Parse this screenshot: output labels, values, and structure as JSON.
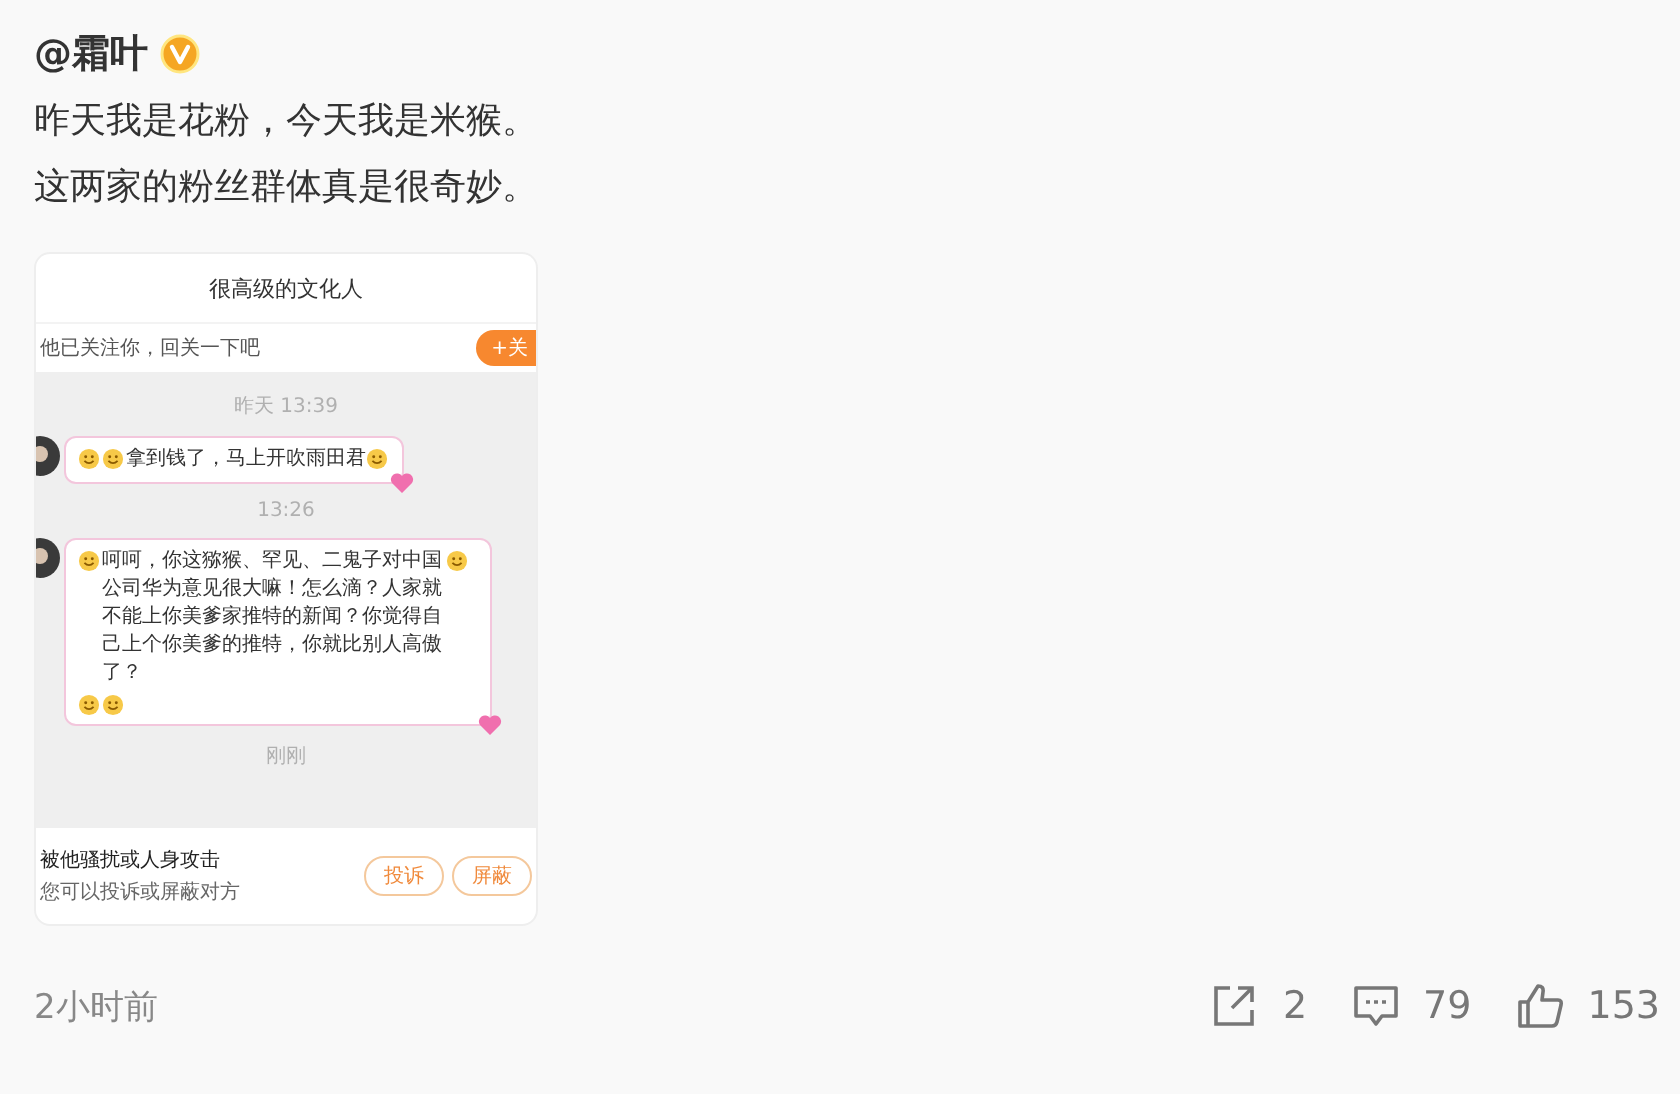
{
  "author": {
    "name": "@霜叶",
    "verified": true
  },
  "text_lines": [
    "昨天我是花粉，今天我是米猴。",
    "这两家的粉丝群体真是很奇妙。"
  ],
  "screenshot": {
    "title": "很高级的文化人",
    "follow_hint": "他已关注你，回关一下吧",
    "follow_button": "+关",
    "messages": [
      {
        "kind": "time",
        "text": "昨天 13:39"
      },
      {
        "kind": "bubble",
        "parts": [
          {
            "kind": "emoji"
          },
          {
            "kind": "emoji"
          },
          {
            "kind": "text",
            "text": "拿到钱了，马上开吹雨田君"
          },
          {
            "kind": "emoji"
          }
        ]
      },
      {
        "kind": "time",
        "text": "13:26"
      },
      {
        "kind": "bubble",
        "parts": [
          {
            "kind": "emoji"
          },
          {
            "kind": "text",
            "text": "呵呵，你这猕猴、罕见、二鬼子对中国公司华为意见很大嘛！怎么滴？人家就不能上你美爹家推特的新闻？你觉得自己上个你美爹的推特，你就比别人高傲了？"
          },
          {
            "kind": "emoji"
          },
          {
            "kind": "emoji"
          },
          {
            "kind": "emoji"
          }
        ]
      },
      {
        "kind": "time",
        "text": "刚刚"
      }
    ],
    "report": {
      "title": "被他骚扰或人身攻击",
      "hint": "您可以投诉或屏蔽对方",
      "buttons": [
        "投诉",
        "屏蔽"
      ]
    }
  },
  "footer": {
    "time": "2小时前",
    "actions": [
      {
        "kind": "share",
        "count": "2"
      },
      {
        "kind": "comment",
        "count": "79"
      },
      {
        "kind": "like",
        "count": "153"
      }
    ]
  }
}
